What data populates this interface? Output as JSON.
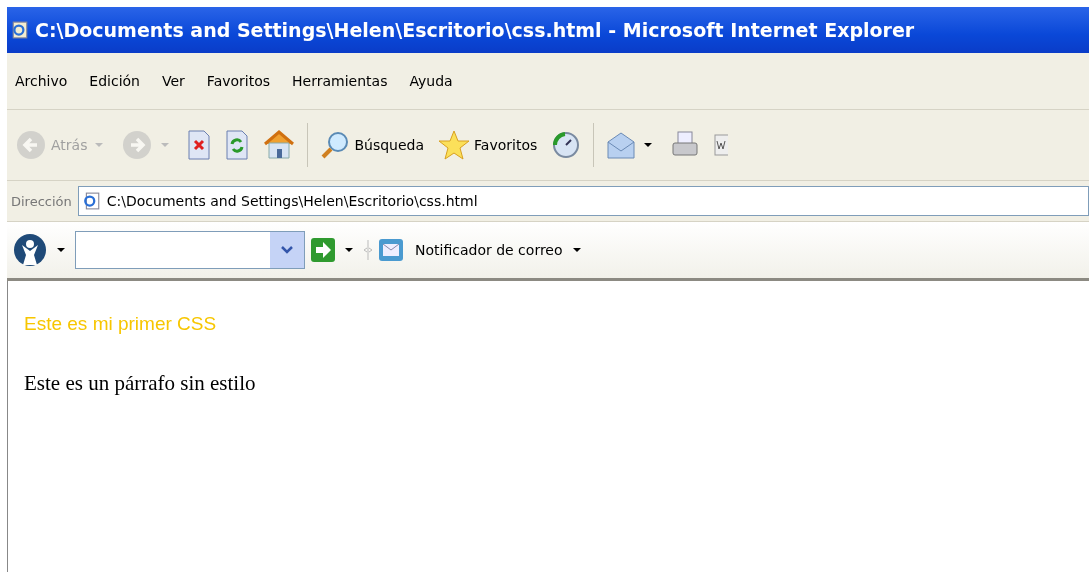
{
  "window": {
    "title": "C:\\Documents and Settings\\Helen\\Escritorio\\css.html - Microsoft Internet Explorer"
  },
  "menu": [
    "Archivo",
    "Edición",
    "Ver",
    "Favoritos",
    "Herramientas",
    "Ayuda"
  ],
  "toolbar": [
    {
      "kind": "back",
      "label": "Atrás",
      "disabled": true,
      "dropdown": true
    },
    {
      "kind": "forward",
      "disabled": true,
      "dropdown": true
    },
    {
      "kind": "stop",
      "disabled": false,
      "dropdown": false
    },
    {
      "kind": "refresh",
      "disabled": false,
      "dropdown": false
    },
    {
      "kind": "home",
      "disabled": false,
      "dropdown": false
    },
    {
      "kind": "sep"
    },
    {
      "kind": "search",
      "label": "Búsqueda",
      "disabled": false,
      "dropdown": false
    },
    {
      "kind": "favorites",
      "label": "Favoritos",
      "disabled": false,
      "dropdown": false
    },
    {
      "kind": "history",
      "disabled": false,
      "dropdown": false
    },
    {
      "kind": "sep"
    },
    {
      "kind": "mail",
      "disabled": false,
      "dropdown": true
    },
    {
      "kind": "print",
      "disabled": false,
      "dropdown": false
    },
    {
      "kind": "word",
      "disabled": false,
      "dropdown": false
    }
  ],
  "address": {
    "label": "Dirección",
    "value": "C:\\Documents and Settings\\Helen\\Escritorio\\css.html"
  },
  "extra_toolbar": {
    "notifier": "Notificador de correo"
  },
  "page": {
    "heading": "Este es mi primer CSS",
    "paragraph": "Este es un párrafo sin estilo"
  }
}
